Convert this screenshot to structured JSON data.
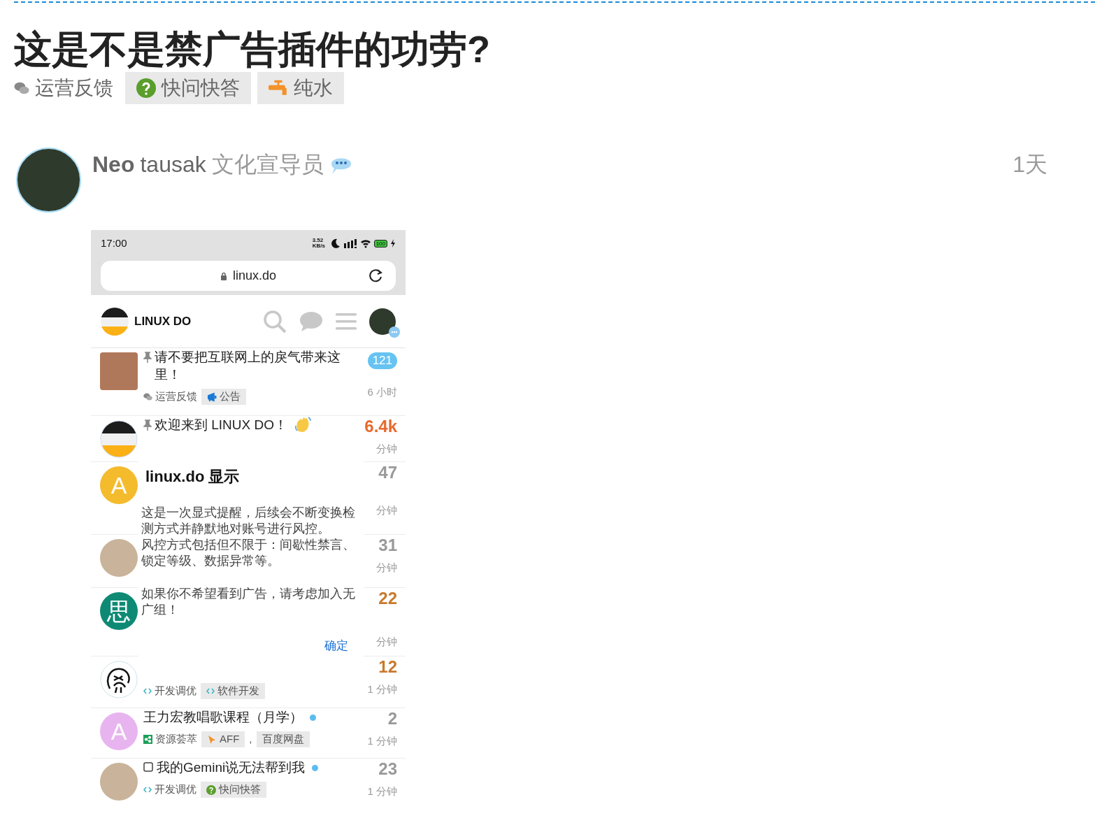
{
  "topic": {
    "title": "这是不是禁广告插件的功劳?",
    "category": {
      "name": "运营反馈"
    },
    "tags": [
      {
        "label": "快问快答",
        "kind": "question"
      },
      {
        "label": "纯水",
        "kind": "faucet"
      }
    ]
  },
  "post": {
    "author": {
      "name": "Neo",
      "username": "tausak",
      "title": "文化宣导员"
    },
    "age": "1天"
  },
  "screenshot": {
    "status_bar": {
      "time": "17:00",
      "speed": "3.52 KB/s",
      "battery": "100"
    },
    "address": "linux.do",
    "site_name": "LINUX DO",
    "topics": [
      {
        "avatar": {
          "kind": "picture"
        },
        "pinned": true,
        "title": "请不要把互联网上的戾气带来这里！",
        "reply_count": {
          "text": "121",
          "kind": "badge"
        },
        "category": {
          "name": "运营反馈",
          "kind": "chat"
        },
        "tags": [
          {
            "label": "公告",
            "kind": "megaphone"
          }
        ],
        "time": "6 小时"
      },
      {
        "avatar": {
          "kind": "logo"
        },
        "pinned": true,
        "title": "欢迎来到 LINUX DO！",
        "wave": true,
        "reply_count": {
          "text": "6.4k",
          "kind": "hot"
        },
        "time": "分钟"
      },
      {
        "avatar": {
          "kind": "letter",
          "letter": "A",
          "color": "#f4bb2c"
        },
        "reply_count": {
          "text": "47",
          "kind": "plain"
        },
        "time": "分钟"
      },
      {
        "avatar": {
          "kind": "picture"
        },
        "reply_count": {
          "text": "31",
          "kind": "plain"
        },
        "time": "分钟"
      },
      {
        "avatar": {
          "kind": "letter",
          "letter": "思",
          "color": "#0e8a74"
        },
        "reply_count": {
          "text": "22",
          "kind": "warm"
        },
        "time": "分钟"
      },
      {
        "avatar": {
          "kind": "drawing"
        },
        "reply_count": {
          "text": "12",
          "kind": "warm"
        },
        "category": {
          "name": "开发调优",
          "kind": "code"
        },
        "tags": [
          {
            "label": "软件开发",
            "kind": "code"
          }
        ],
        "time": "1 分钟"
      },
      {
        "avatar": {
          "kind": "letter",
          "letter": "A",
          "color": "#e8b4f0"
        },
        "title": "王力宏教唱歌课程（月学）",
        "unread": true,
        "reply_count": {
          "text": "2",
          "kind": "plain"
        },
        "category": {
          "name": "资源荟萃",
          "kind": "share"
        },
        "tags": [
          {
            "label": "AFF",
            "kind": "cursor"
          },
          {
            "label": "百度网盘",
            "kind": "plain"
          }
        ],
        "tag_separator": ",",
        "time": "1 分钟"
      },
      {
        "avatar": {
          "kind": "picture"
        },
        "checkbox": true,
        "title": "我的Gemini说无法帮到我",
        "unread": true,
        "reply_count": {
          "text": "23",
          "kind": "plain"
        },
        "category": {
          "name": "开发调优",
          "kind": "code"
        },
        "tags": [
          {
            "label": "快问快答",
            "kind": "question"
          }
        ],
        "time": "1 分钟"
      }
    ],
    "dialog": {
      "title": "linux.do 显示",
      "paragraphs": [
        "这是一次显式提醒，后续会不断变换检测方式并静默地对账号进行风控。",
        "风控方式包括但不限于：间歇性禁言、锁定等级、数据异常等。",
        "如果你不希望看到广告，请考虑加入无广组！"
      ],
      "button": "确定"
    }
  }
}
